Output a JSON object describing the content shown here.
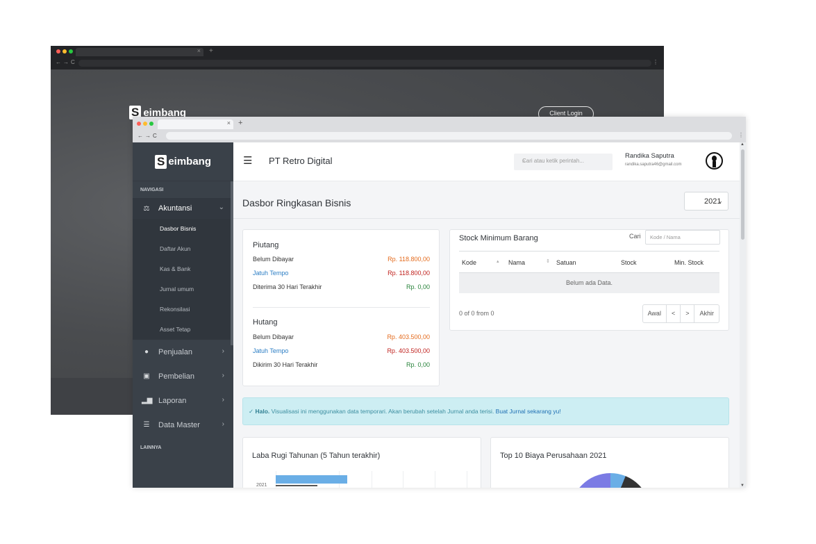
{
  "back_window": {
    "brand_letter": "S",
    "brand_name": "eimbang",
    "client_login": "Client Login"
  },
  "sidebar": {
    "brand_letter": "S",
    "brand_name": "eimbang",
    "section_nav": "NAVIGASI",
    "section_other": "LAINNYA",
    "akuntansi": {
      "label": "Akuntansi",
      "icon": "scale-icon",
      "sub_items": [
        {
          "label": "Dasbor Bisnis",
          "active": true
        },
        {
          "label": "Daftar Akun"
        },
        {
          "label": "Kas & Bank"
        },
        {
          "label": "Jurnal umum"
        },
        {
          "label": "Rekonsilasi"
        },
        {
          "label": "Asset Tetap"
        }
      ]
    },
    "items": [
      {
        "label": "Penjualan",
        "icon": "tag-icon"
      },
      {
        "label": "Pembelian",
        "icon": "bag-icon"
      },
      {
        "label": "Laporan",
        "icon": "bar-chart-icon"
      },
      {
        "label": "Data Master",
        "icon": "list-icon"
      }
    ]
  },
  "header": {
    "company": "PT Retro Digital",
    "search_placeholder": "Cari atau ketik perintah...",
    "user_name": "Randika Saputra",
    "user_email": "randika.saputra46@gmail.com"
  },
  "page": {
    "title": "Dasbor Ringkasan Bisnis",
    "year": "2021"
  },
  "piutang": {
    "title": "Piutang",
    "rows": [
      {
        "label": "Belum Dibayar",
        "value": "Rp. 118.800,00"
      },
      {
        "label": "Jatuh Tempo",
        "value": "Rp. 118.800,00"
      },
      {
        "label": "Diterima 30 Hari Terakhir",
        "value": "Rp. 0,00"
      }
    ]
  },
  "hutang": {
    "title": "Hutang",
    "rows": [
      {
        "label": "Belum Dibayar",
        "value": "Rp. 403.500,00"
      },
      {
        "label": "Jatuh Tempo",
        "value": "Rp. 403.500,00"
      },
      {
        "label": "Dikirim 30 Hari Terakhir",
        "value": "Rp. 0,00"
      }
    ]
  },
  "stock": {
    "title": "Stock Minimum Barang",
    "search_label": "Cari",
    "search_placeholder": "Kode / Nama",
    "columns": [
      "Kode",
      "Nama",
      "Satuan",
      "Stock",
      "Min. Stock"
    ],
    "empty_text": "Belum ada Data.",
    "pager_info": "0 of 0 from 0",
    "pager": {
      "first": "Awal",
      "prev": "<",
      "next": ">",
      "last": "Akhir"
    }
  },
  "alert": {
    "icon": "check-icon",
    "bold": "Halo.",
    "text": " Visualisasi ini menggunakan data temporari. Akan berubah setelah Jurnal anda terisi. ",
    "link": "Buat Jurnal sekarang yu!"
  },
  "laba_rugi": {
    "title": "Laba Rugi Tahunan (5 Tahun terakhir)",
    "year_label": "2021"
  },
  "biaya": {
    "title": "Top 10 Biaya Perusahaan 2021"
  },
  "colors": {
    "sidebar": "#3a4149",
    "accent_blue": "#2a7dc4",
    "orange": "#e46a1c",
    "red": "#c0221e",
    "green": "#27823a",
    "alert_bg": "#cdeef3"
  }
}
